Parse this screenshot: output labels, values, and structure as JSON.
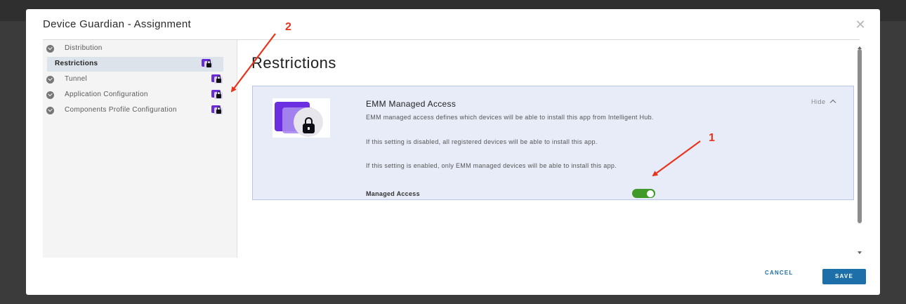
{
  "modal": {
    "title": "Device Guardian - Assignment",
    "close_icon": "close-icon"
  },
  "sidebar": {
    "items": [
      {
        "label": "Distribution",
        "status": "complete",
        "locked": false,
        "active": false
      },
      {
        "label": "Restrictions",
        "status": "none",
        "locked": true,
        "active": true
      },
      {
        "label": "Tunnel",
        "status": "complete",
        "locked": true,
        "active": false
      },
      {
        "label": "Application Configuration",
        "status": "complete",
        "locked": true,
        "active": false
      },
      {
        "label": "Components Profile Configuration",
        "status": "complete",
        "locked": true,
        "active": false
      }
    ]
  },
  "main": {
    "title": "Restrictions",
    "card": {
      "heading": "EMM Managed Access",
      "hide_label": "Hide",
      "paragraphs": [
        "EMM managed access defines which devices will be able to install this app from Intelligent Hub.",
        "If this setting is disabled, all registered devices will be able to install this app.",
        "If this setting is enabled, only EMM managed devices will be able to install this app."
      ],
      "managed_access_label": "Managed Access",
      "managed_access_enabled": true
    }
  },
  "footer": {
    "cancel_label": "CANCEL",
    "save_label": "SAVE"
  },
  "annotations": {
    "label_1": "1",
    "label_2": "2",
    "color": "#e8341c"
  },
  "colors": {
    "accent": "#1c6fa8",
    "toggle_on": "#3f9a2a",
    "card_bg": "#e8ecf8",
    "lock_purple": "#6a2bd9"
  }
}
